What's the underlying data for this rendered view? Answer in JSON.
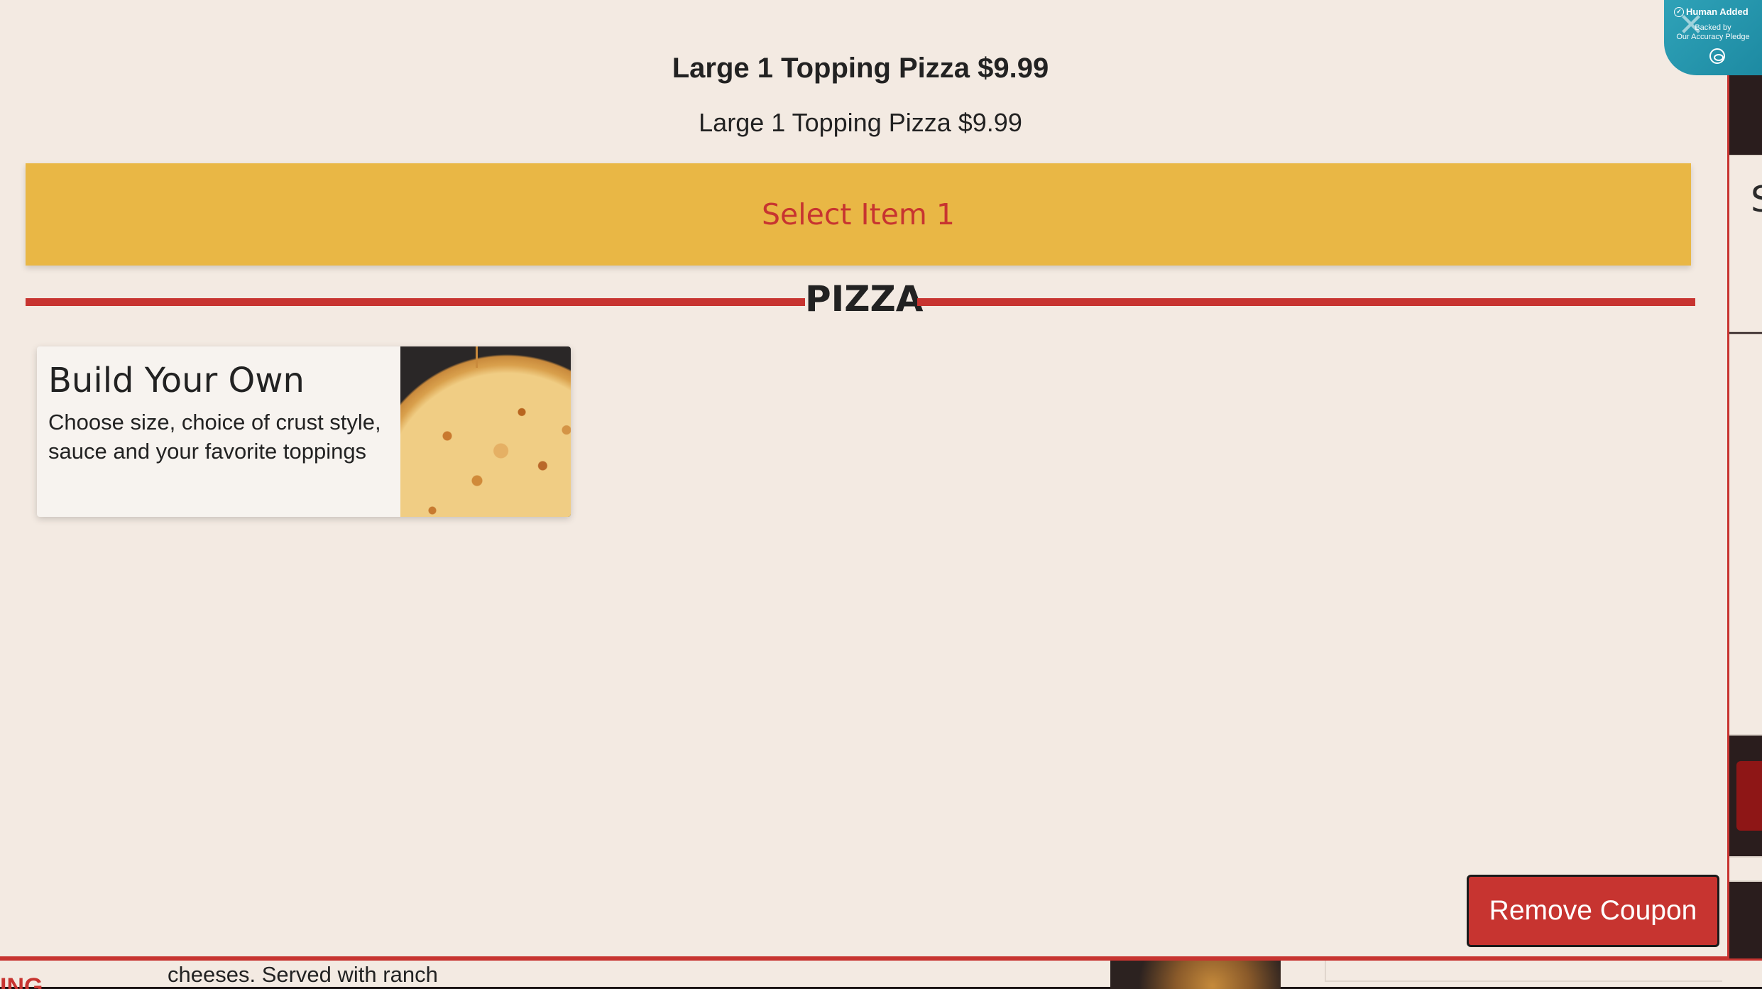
{
  "modal": {
    "title": "Large 1 Topping Pizza $9.99",
    "subtitle": "Large 1 Topping Pizza $9.99",
    "select_label": "Select Item 1",
    "category": "PIZZA",
    "items": [
      {
        "name": "Build Your Own",
        "description": "Choose size, choice of crust style, sauce and your favorite toppings"
      }
    ],
    "remove_coupon_label": "Remove Coupon",
    "close_icon": "close-icon"
  },
  "badge": {
    "title": "Human Added",
    "line1": "Backed by",
    "line2": "Our Accuracy Pledge"
  },
  "background": {
    "peek_text": "cheeses. Served with ranch",
    "peek_red_text": "ING",
    "peek_letter": "S"
  },
  "colors": {
    "modal_bg": "#f3eae2",
    "accent_red": "#c73430",
    "select_bar": "#e9b745",
    "badge": "#2fa2b8"
  }
}
